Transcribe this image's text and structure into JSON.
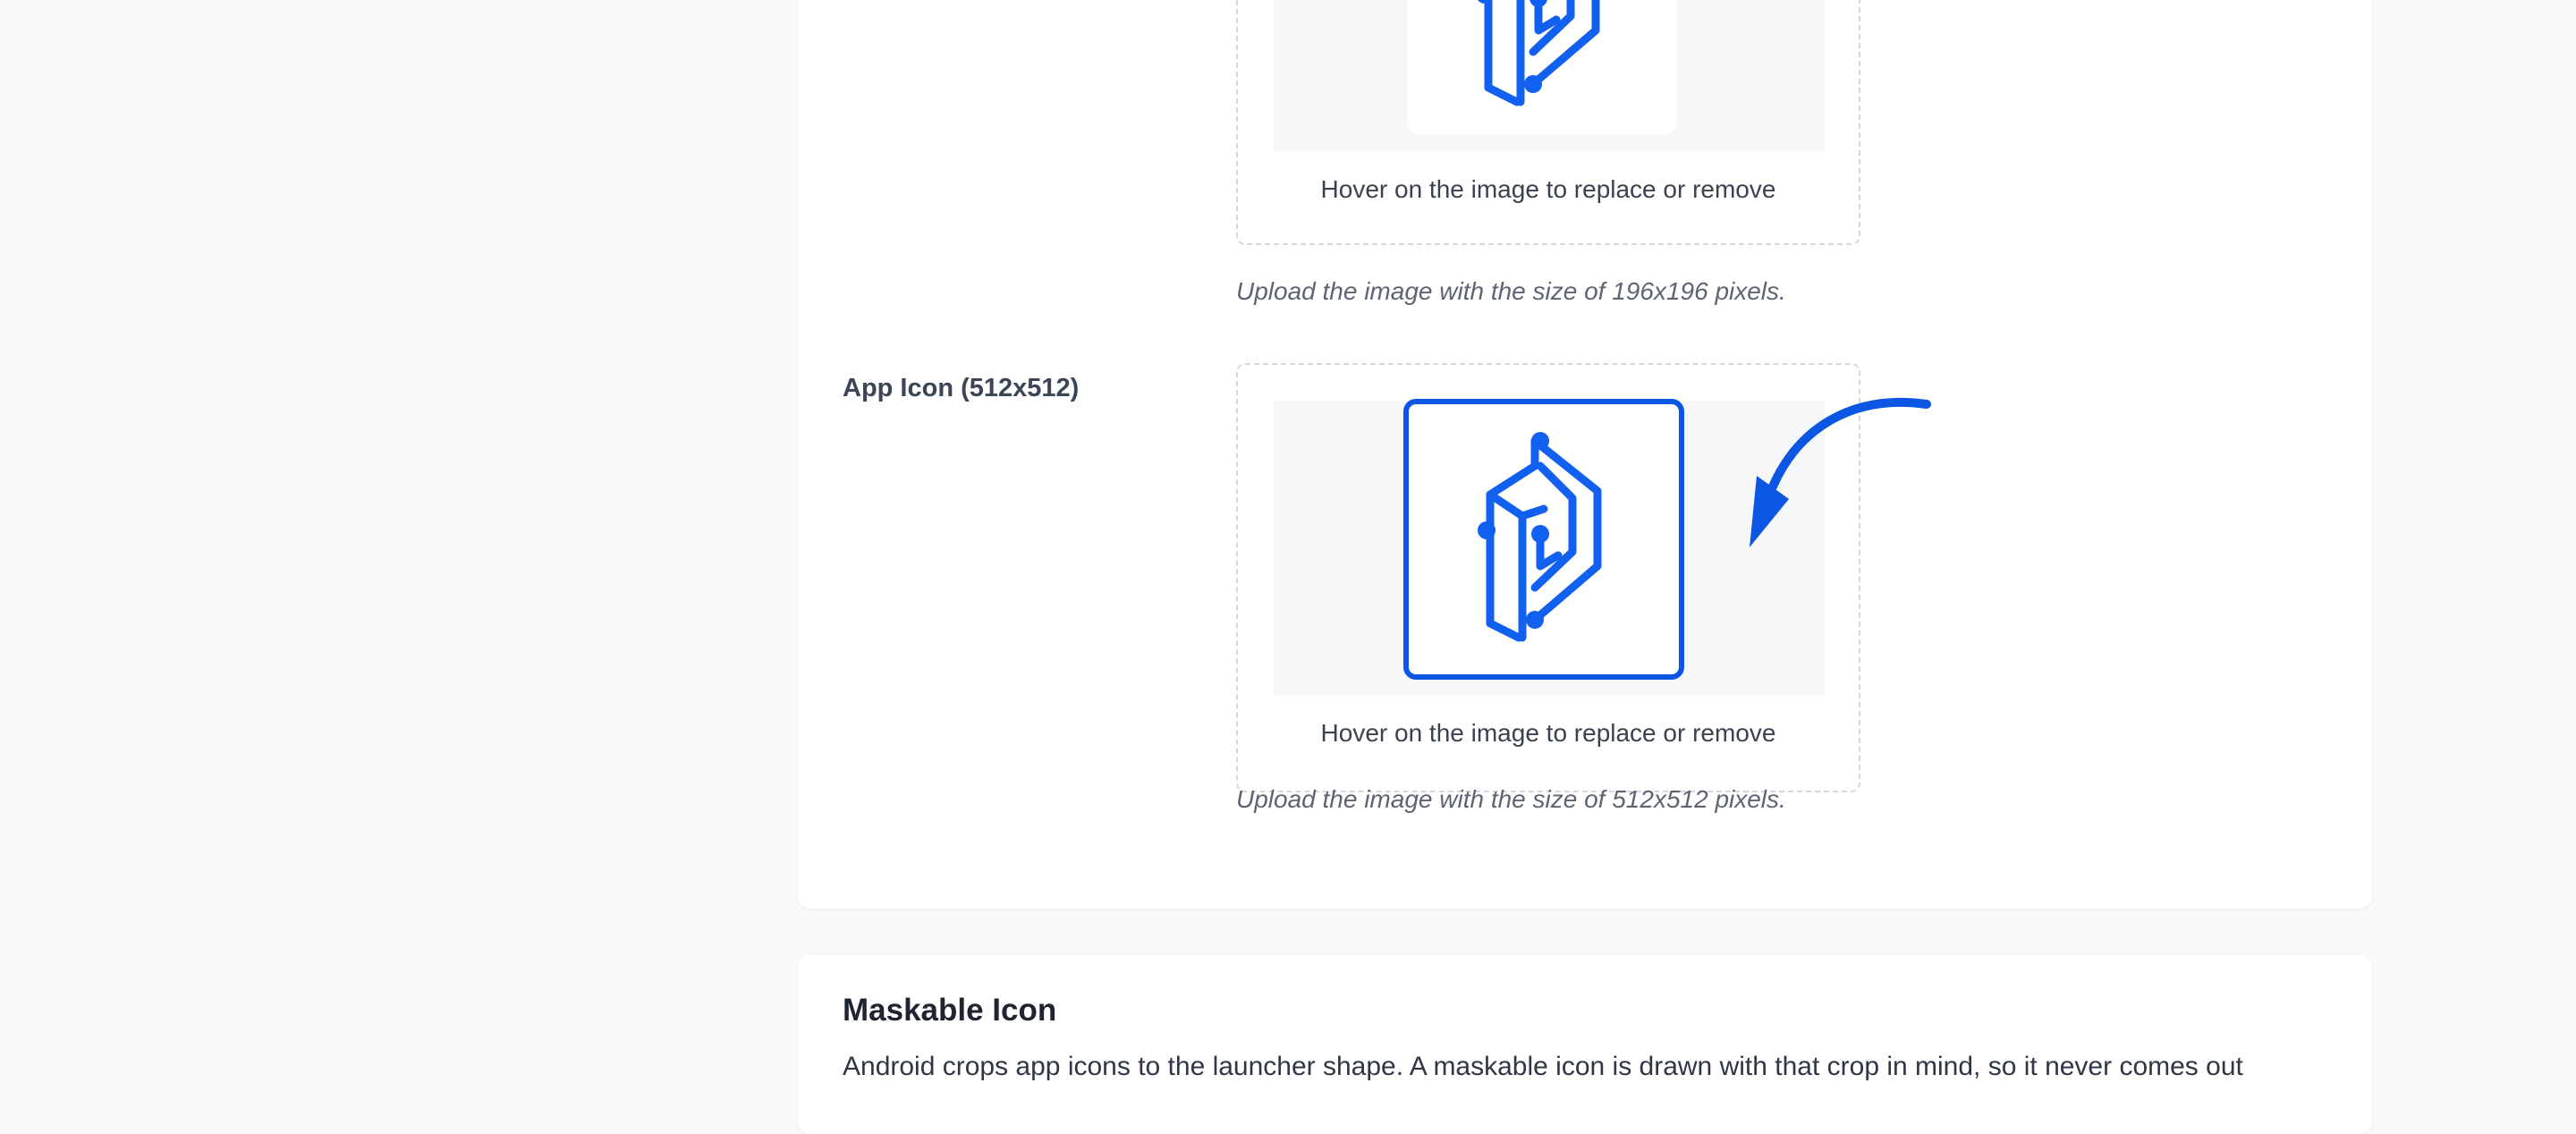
{
  "app_icon_192": {
    "hover_text": "Hover on the image to replace or remove",
    "hint": "Upload the image with the size of 196x196 pixels."
  },
  "app_icon_512": {
    "label": "App Icon (512x512)",
    "hover_text": "Hover on the image to replace or remove",
    "hint": "Upload the image with the size of 512x512 pixels."
  },
  "maskable_icon": {
    "title": "Maskable Icon",
    "description": "Android crops app icons to the launcher shape. A maskable icon is drawn with that crop in mind, so it never comes out"
  },
  "icons": {
    "logo": "brand-logo-icon",
    "annotation": "curved-arrow-icon"
  },
  "colors": {
    "accent": "#0b57e3",
    "logo": "#1160f0"
  }
}
